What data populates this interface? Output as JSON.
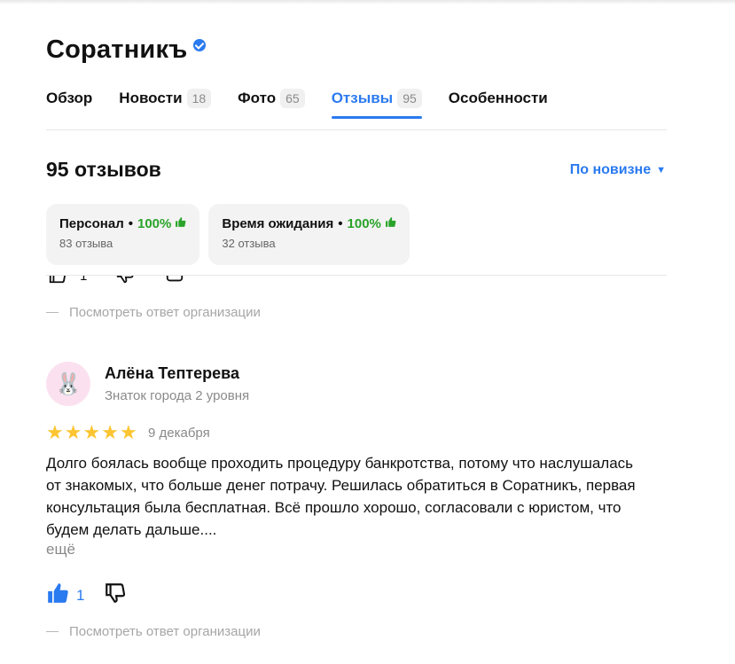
{
  "app": {
    "title": "Соратникъ",
    "verified": true,
    "accent_color": "#2a7af0"
  },
  "tabs": [
    {
      "label": "Обзор",
      "count": null,
      "active": false
    },
    {
      "label": "Новости",
      "count": "18",
      "active": false
    },
    {
      "label": "Фото",
      "count": "65",
      "active": false
    },
    {
      "label": "Отзывы",
      "count": "95",
      "active": true
    },
    {
      "label": "Особенности",
      "count": null,
      "active": false
    }
  ],
  "reviews": {
    "count_label": "95 отзывов",
    "sort_label": "По новизне",
    "categories": [
      {
        "name": "Персонал",
        "percent": "100%",
        "sub": "83 отзыва",
        "icon": "thumbs-up-icon"
      },
      {
        "name": "Время ожидания",
        "percent": "100%",
        "sub": "32 отзыва",
        "icon": "thumbs-up-icon"
      }
    ],
    "org_reply_label": "Посмотреть ответ организации",
    "review": {
      "avatar_icon": "bunny-icon",
      "author": "Алёна Тептерева",
      "level": "Знаток города 2 уровня",
      "rating": 5,
      "date": "9 декабря",
      "text": "Долго боялась вообще проходить процедуру банкротства, потому что наслушалась от знакомых, что больше денег потрачу. Решилась обратиться в Соратникъ, первая консультация была бесплатная. Всё прошло хорошо, согласовали с юристом, что будем делать дальше....",
      "more_label": "ещё",
      "likes": "1",
      "org_reply_label": "Посмотреть ответ организации"
    }
  }
}
